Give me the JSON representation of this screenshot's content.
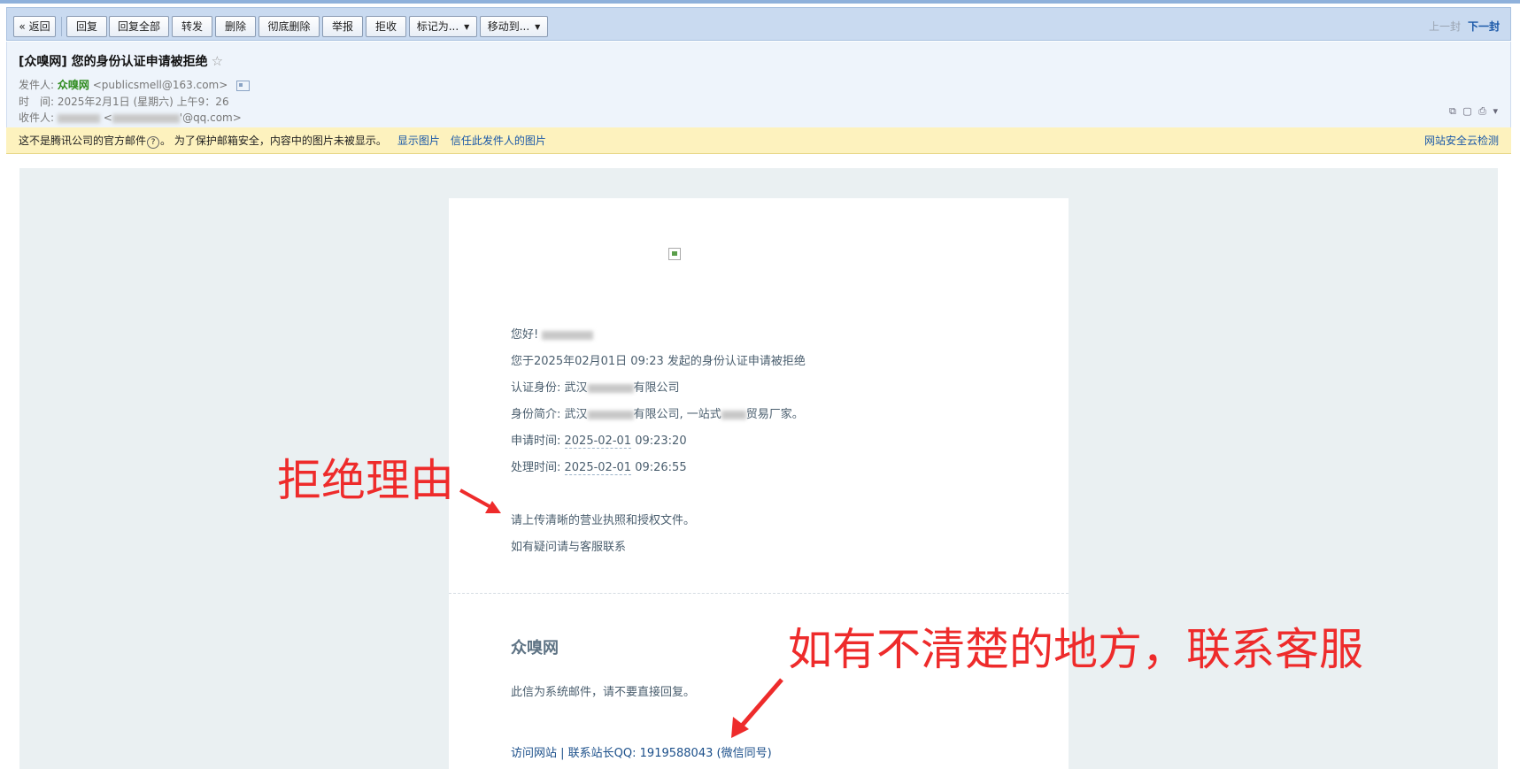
{
  "toolbar": {
    "buttons": {
      "back": "« 返回",
      "reply": "回复",
      "reply_all": "回复全部",
      "forward": "转发",
      "delete": "删除",
      "delete_permanent": "彻底删除",
      "report": "举报",
      "reject": "拒收",
      "mark_as": "标记为...",
      "move_to": "移动到..."
    },
    "prev": "上一封",
    "next": "下一封"
  },
  "header": {
    "subject": "[众嗅网] 您的身份认证申请被拒绝",
    "star": "☆",
    "sender_label": "发件人:",
    "sender_name": "众嗅网",
    "sender_email": "<publicsmell@163.com>",
    "time_label": "时　间:",
    "time_value": "2025年2月1日 (星期六) 上午9：26",
    "recipient_label": "收件人:",
    "recipient_email_prefix": "<",
    "recipient_email_suffix": "'@qq.com>",
    "tools": "⧉ ▢ ⎙ ▾"
  },
  "warning": {
    "text_before": "这不是腾讯公司的官方邮件",
    "qmark": "?",
    "text_after": "。 为了保护邮箱安全，内容中的图片未被显示。",
    "show_images": "显示图片",
    "trust_sender": "信任此发件人的图片",
    "cloud_check": "网站安全云检测"
  },
  "mail": {
    "greeting": "您好!",
    "line1": "您于2025年02月01日 09:23 发起的身份认证申请被拒绝",
    "identity_label": "认证身份: 武汉",
    "identity_suffix": "有限公司",
    "intro_label": "身份简介: 武汉",
    "intro_mid": "有限公司, 一站式",
    "intro_suffix": "贸易厂家。",
    "apply_label": "申请时间: ",
    "apply_date": "2025-02-01",
    "apply_time": " 09:23:20",
    "process_label": "处理时间: ",
    "process_date": "2025-02-01",
    "process_time": " 09:26:55",
    "reason": "请上传清晰的营业执照和授权文件。",
    "contact": "如有疑问请与客服联系",
    "brand": "众嗅网",
    "system_note": "此信为系统邮件，请不要直接回复。",
    "visit_site": "访问网站",
    "separator": " | ",
    "contact_qq": "联系站长QQ: 1919588043 (微信同号)"
  },
  "annotations": {
    "reason_label": "拒绝理由",
    "contact_label": "如有不清楚的地方，联系客服"
  }
}
